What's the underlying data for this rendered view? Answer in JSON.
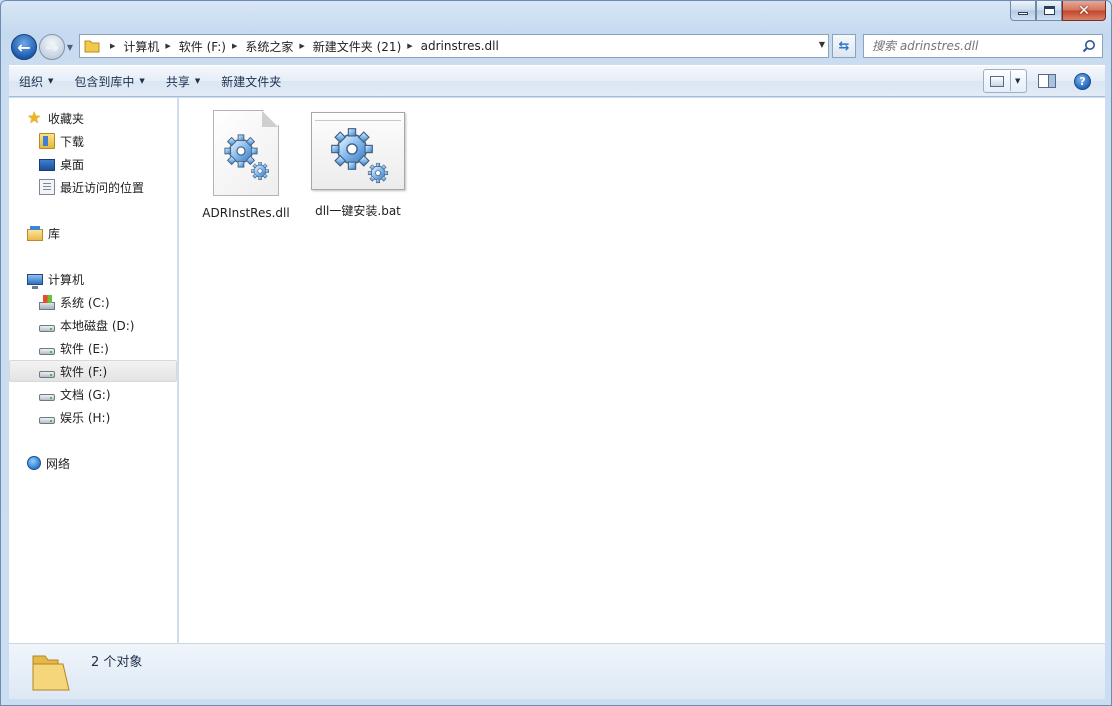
{
  "address": {
    "crumbs": [
      "计算机",
      "软件 (F:)",
      "系统之家",
      "新建文件夹 (21)",
      "adrinstres.dll"
    ]
  },
  "search": {
    "placeholder": "搜索 adrinstres.dll"
  },
  "toolbar": {
    "organize": "组织",
    "include_in_library": "包含到库中",
    "share": "共享",
    "new_folder": "新建文件夹"
  },
  "sidebar": {
    "favorites": "收藏夹",
    "downloads": "下载",
    "desktop": "桌面",
    "recent": "最近访问的位置",
    "libraries": "库",
    "computer": "计算机",
    "drives": [
      "系统 (C:)",
      "本地磁盘 (D:)",
      "软件 (E:)",
      "软件 (F:)",
      "文档 (G:)",
      "娱乐 (H:)"
    ],
    "network": "网络"
  },
  "files": [
    {
      "name": "ADRInstRes.dll",
      "type": "dll"
    },
    {
      "name": "dll一键安装.bat",
      "type": "bat"
    }
  ],
  "status": {
    "count_text": "2 个对象"
  },
  "colors": {
    "accent": "#1b5cb0",
    "close": "#c2462a",
    "gear": "#5f9fe0"
  }
}
